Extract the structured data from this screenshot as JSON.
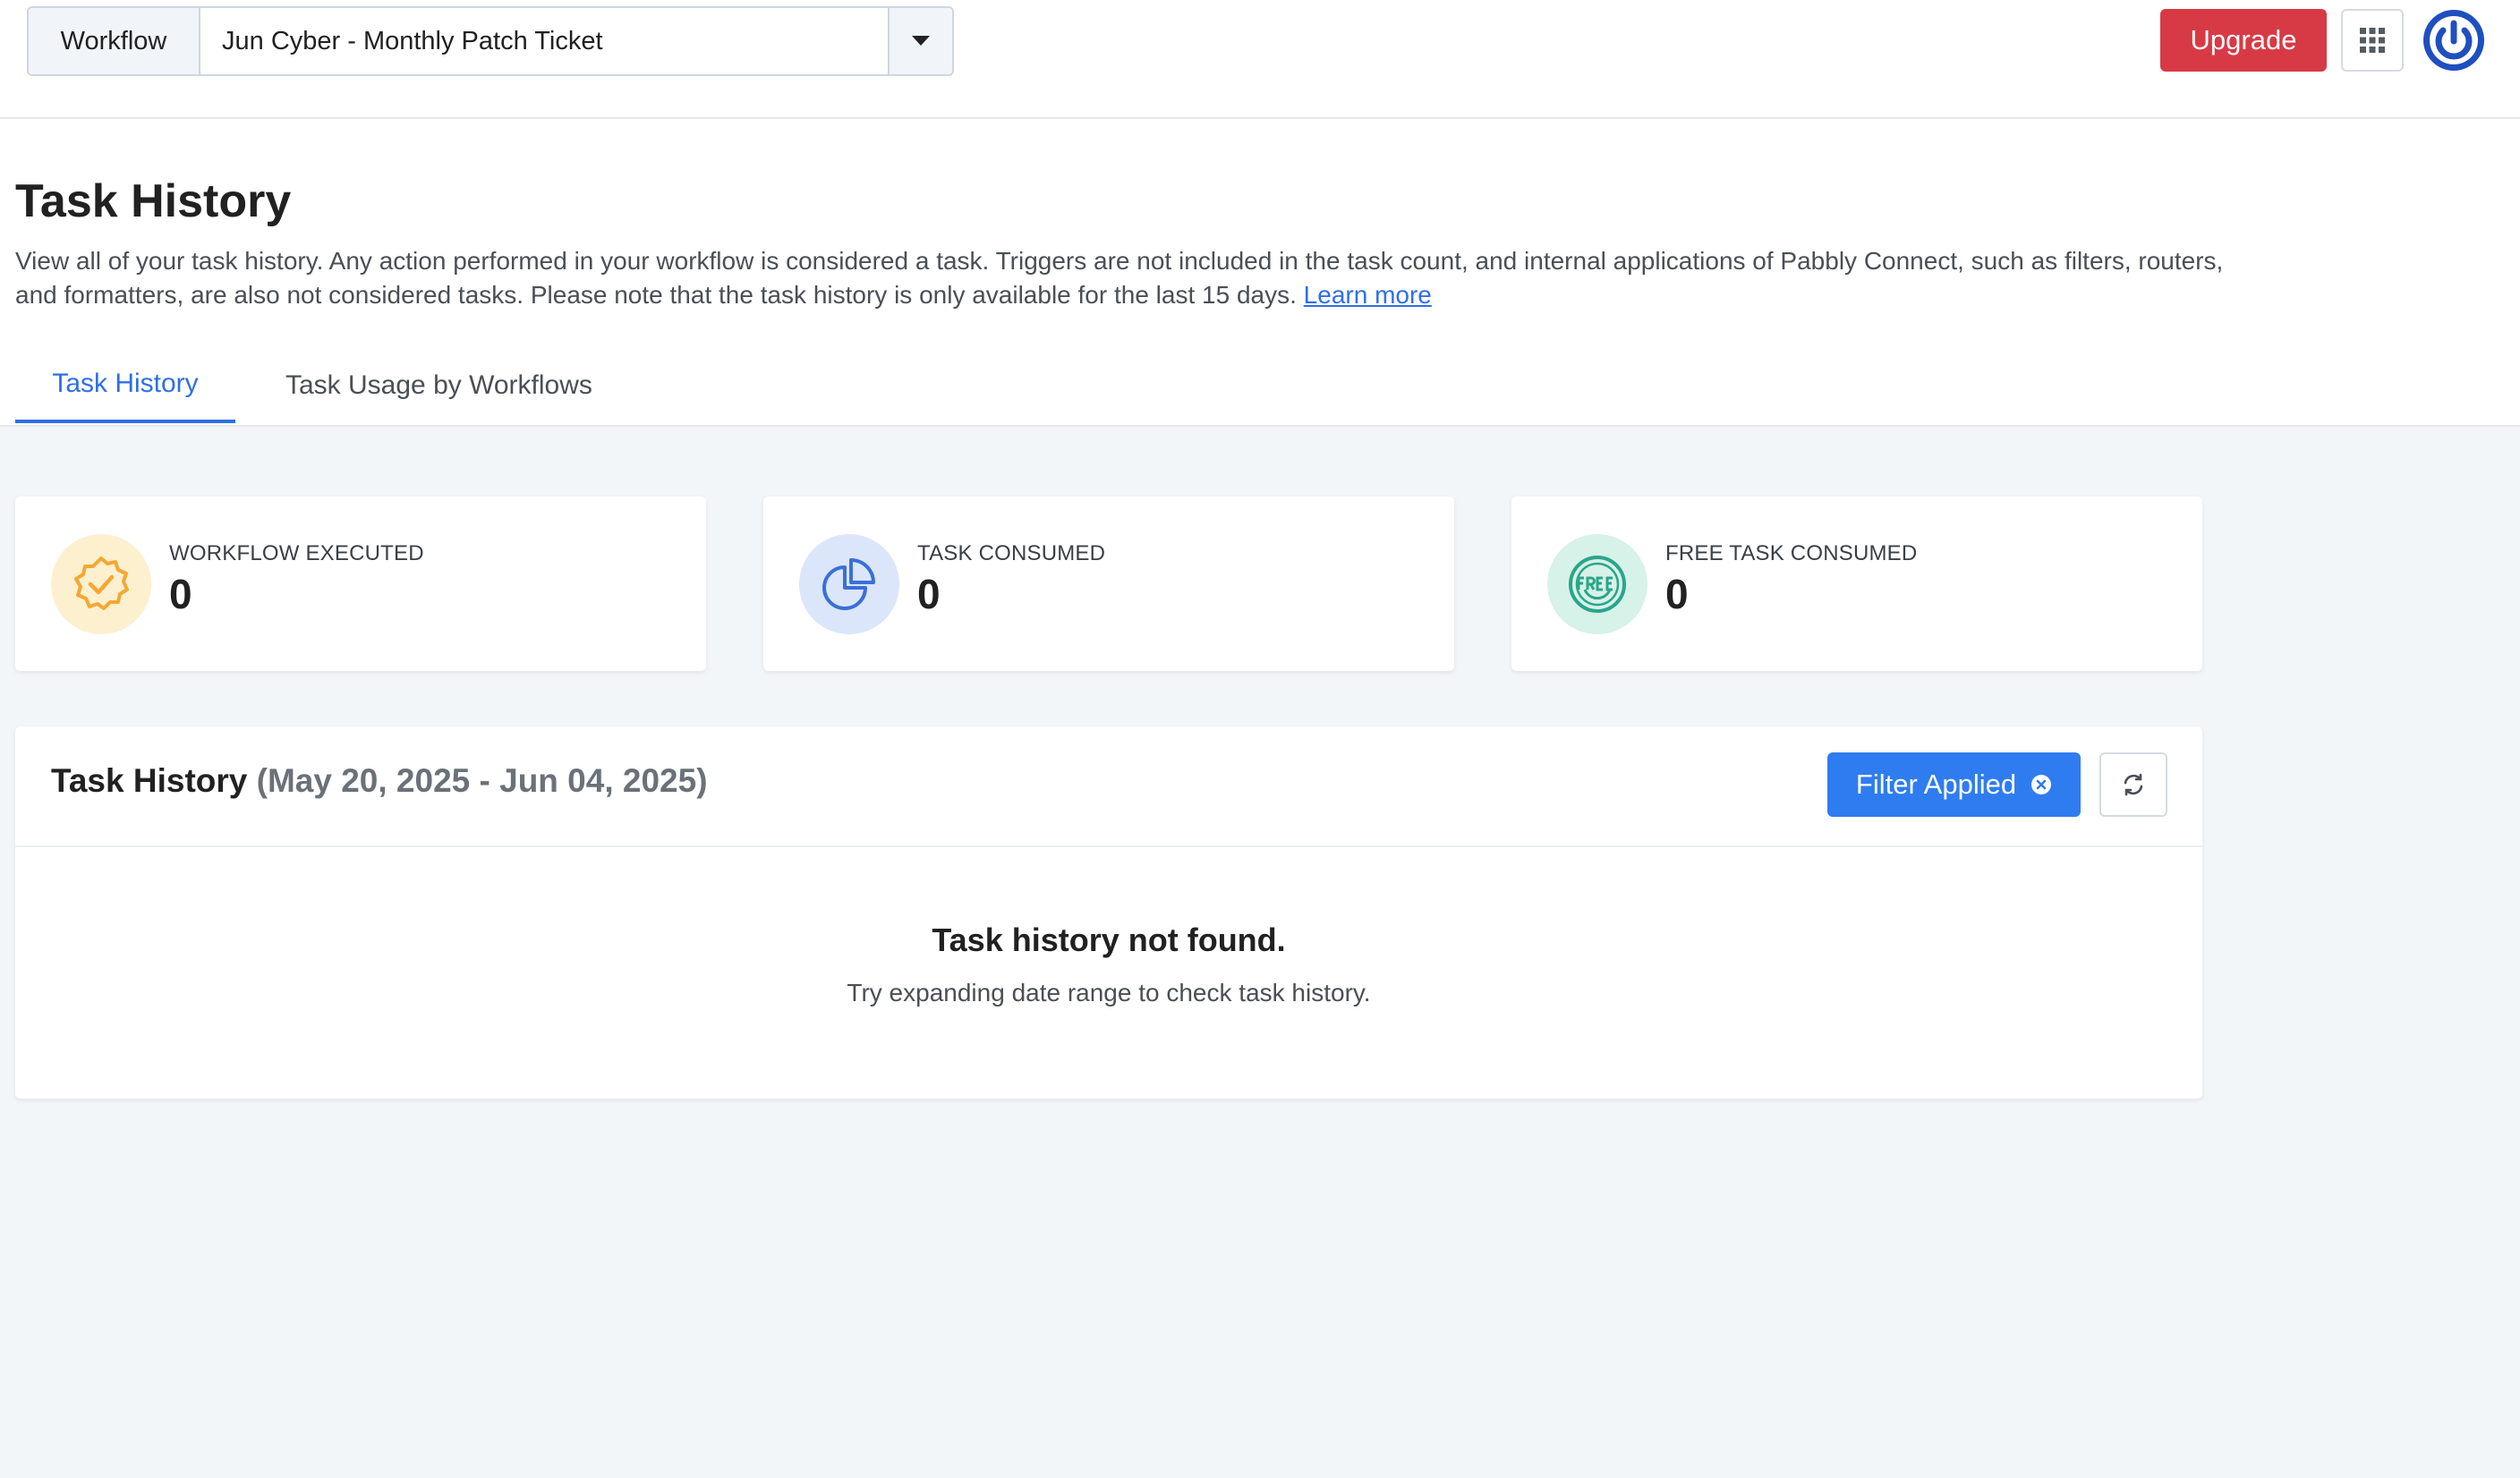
{
  "topbar": {
    "workflow_label": "Workflow",
    "workflow_selected": "Jun Cyber - Monthly Patch Ticket",
    "upgrade_label": "Upgrade",
    "icons": {
      "caret": "chevron-down-icon",
      "apps": "apps-grid-icon",
      "power": "power-icon"
    },
    "colors": {
      "upgrade": "#d83a45",
      "power": "#1f4fbf"
    }
  },
  "header": {
    "title": "Task History",
    "description": "View all of your task history. Any action performed in your workflow is considered a task. Triggers are not included in the task count, and internal applications of Pabbly Connect, such as filters, routers, and formatters, are also not considered tasks. Please note that the task history is only available for the last 15 days.",
    "learn_more": "Learn more",
    "tabs": [
      {
        "label": "Task History",
        "active": true
      },
      {
        "label": "Task Usage by Workflows",
        "active": false
      }
    ]
  },
  "stats": [
    {
      "label": "WORKFLOW EXECUTED",
      "value": "0",
      "icon": "badge-check-icon",
      "color": "#f4a833"
    },
    {
      "label": "TASK CONSUMED",
      "value": "0",
      "icon": "pie-chart-icon",
      "color": "#3a6fd8"
    },
    {
      "label": "FREE TASK CONSUMED",
      "value": "0",
      "icon": "free-badge-icon",
      "color": "#2aa58a"
    }
  ],
  "history": {
    "title": "Task History",
    "range": "(May 20, 2025 - Jun 04, 2025)",
    "filter_label": "Filter Applied",
    "filter_icon": "close-circle-icon",
    "refresh_icon": "refresh-icon",
    "empty_title": "Task history not found.",
    "empty_subtitle": "Try expanding date range to check task history.",
    "accent": "#2f7cf0"
  }
}
